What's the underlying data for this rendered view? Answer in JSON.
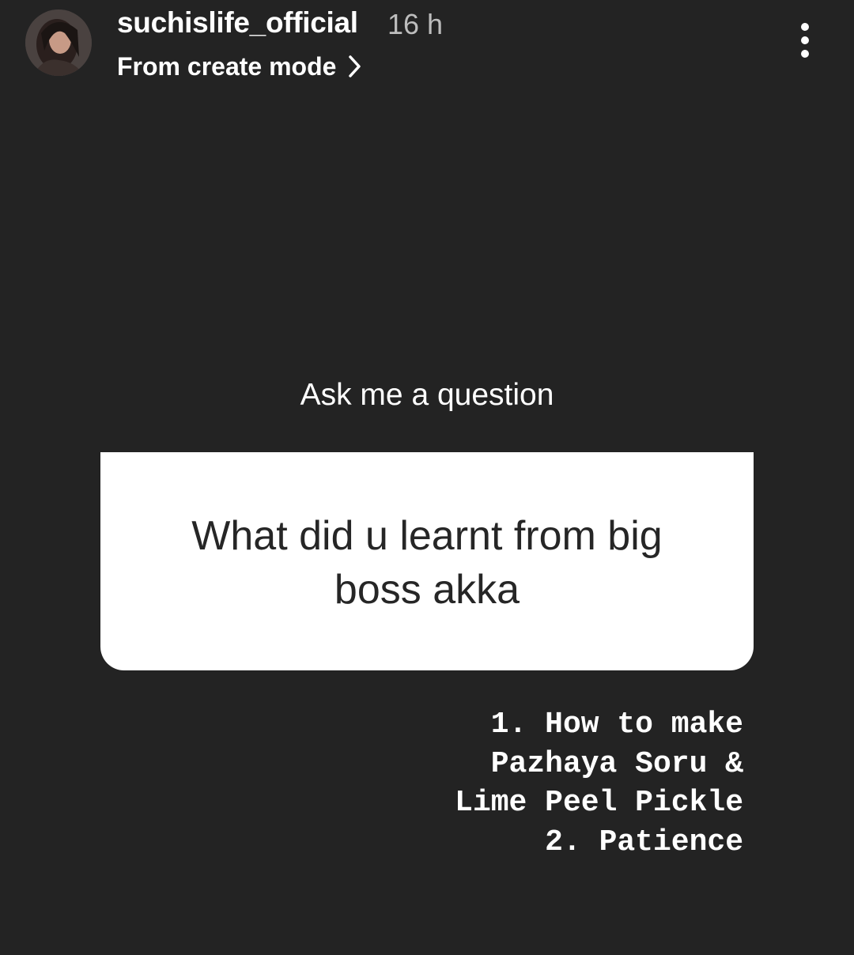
{
  "story_header": {
    "username": "suchislife_official",
    "timestamp": "16 h",
    "source_label": "From create mode",
    "avatar_icon": "profile-photo",
    "chevron_icon": "chevron-right-icon",
    "more_icon": "more-vertical-icon"
  },
  "question_sticker": {
    "prompt": "Ask me a question",
    "question": "What did u learnt from big boss akka"
  },
  "answer": {
    "lines": [
      "1. How to make",
      "Pazhaya Soru &",
      "Lime Peel Pickle",
      "2. Patience"
    ]
  },
  "colors": {
    "background": "#232323",
    "card": "#ffffff",
    "question_text": "#262626",
    "timestamp_text": "#bdbdbd"
  }
}
